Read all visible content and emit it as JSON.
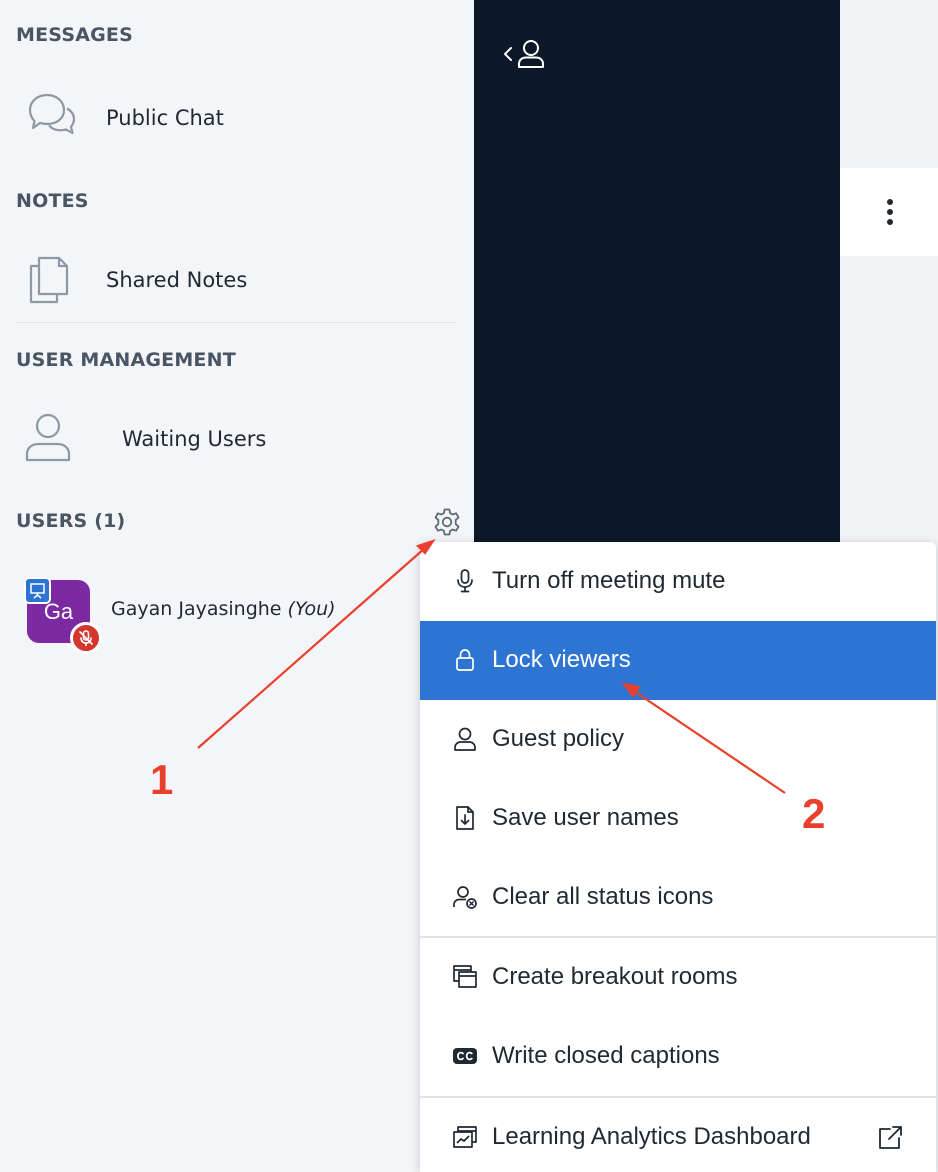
{
  "sidebar": {
    "messages_title": "MESSAGES",
    "public_chat": "Public Chat",
    "notes_title": "NOTES",
    "shared_notes": "Shared Notes",
    "user_management_title": "USER MANAGEMENT",
    "waiting_users": "Waiting Users",
    "users_title": "USERS (1)",
    "user": {
      "initials": "Ga",
      "name": "Gayan Jayasinghe",
      "you_suffix": "(You)",
      "avatar_color": "#7c2aa2",
      "presenter_badge_icon": "presentation-icon",
      "mic_badge_icon": "mic-muted-icon"
    }
  },
  "menu": {
    "items": [
      {
        "label": "Turn off meeting mute",
        "icon": "microphone-icon"
      },
      {
        "label": "Lock viewers",
        "icon": "lock-icon",
        "active": true
      },
      {
        "label": "Guest policy",
        "icon": "user-icon"
      },
      {
        "label": "Save user names",
        "icon": "download-file-icon"
      },
      {
        "label": "Clear all status icons",
        "icon": "user-clear-icon"
      },
      {
        "label": "Create breakout rooms",
        "icon": "breakout-rooms-icon"
      },
      {
        "label": "Write closed captions",
        "icon": "closed-captions-icon"
      },
      {
        "label": "Learning Analytics Dashboard",
        "icon": "analytics-icon",
        "external": true
      }
    ]
  },
  "annotations": {
    "step1": "1",
    "step2": "2",
    "color": "#e8402c"
  },
  "colors": {
    "accent": "#2e74d3",
    "dark_panel": "#0c1828",
    "sidebar_bg": "#f3f5f8"
  }
}
